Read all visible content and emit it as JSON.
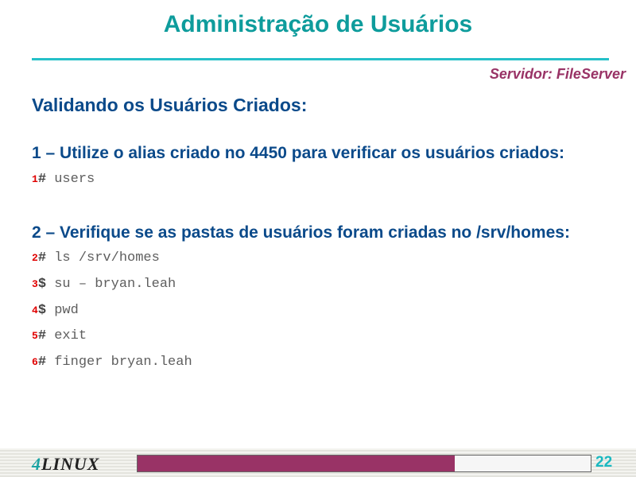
{
  "title": "Administração de Usuários",
  "server": "Servidor: FileServer",
  "heading": "Validando os Usuários Criados:",
  "steps": [
    {
      "text": "1 – Utilize o alias criado no 4450 para verificar os usuários criados:"
    },
    {
      "text": "2 – Verifique se as pastas de usuários foram criadas no /srv/homes:"
    }
  ],
  "commands": [
    {
      "n": "1",
      "p": "#",
      "c": " users"
    },
    {
      "n": "2",
      "p": "#",
      "c": " ls /srv/homes"
    },
    {
      "n": "3",
      "p": "$",
      "c": " su – bryan.leah"
    },
    {
      "n": "4",
      "p": "$",
      "c": " pwd"
    },
    {
      "n": "5",
      "p": "#",
      "c": " exit"
    },
    {
      "n": "6",
      "p": "#",
      "c": " finger bryan.leah"
    }
  ],
  "footer": {
    "logo_num": "4",
    "logo_text": "LINUX",
    "page": "22",
    "progress": 0.7,
    "progress_color": "#993366"
  }
}
